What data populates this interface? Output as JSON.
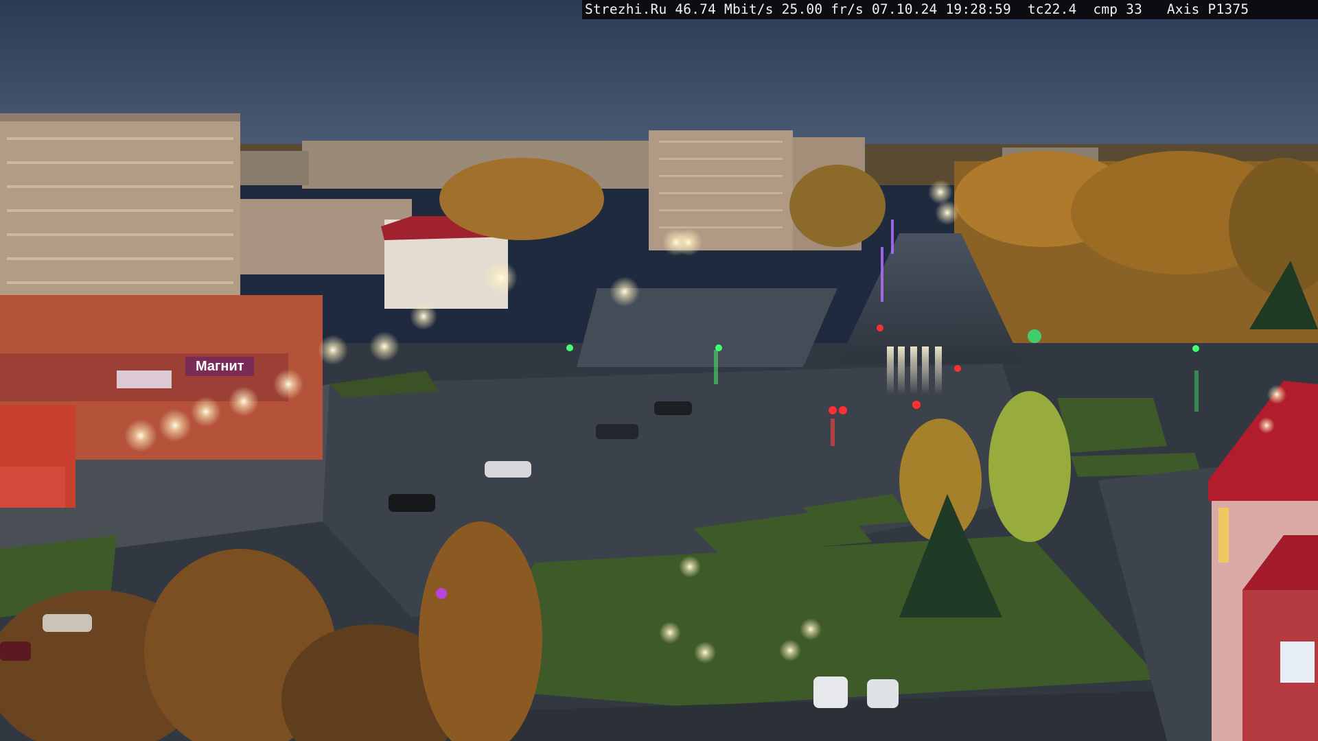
{
  "camera_overlay": {
    "site": "Strezhi.Ru",
    "bitrate": "46.74 Mbit/s",
    "frame_rate": "25.00 fr/s",
    "date": "07.10.24",
    "time": "19:28:59",
    "tc": "tc22.4",
    "cmp": "cmp 33",
    "camera_model": "Axis P1375"
  },
  "signage": {
    "store_sign": "Магнит"
  },
  "colors": {
    "sky": "#3a4a66",
    "asphalt": "#3c4450",
    "grass": "#3f5a2a",
    "autumn_foliage": "#b8822e",
    "building_brick": "#b8533a",
    "roof_red": "#b21f2c",
    "street_light": "#fff6d8"
  }
}
